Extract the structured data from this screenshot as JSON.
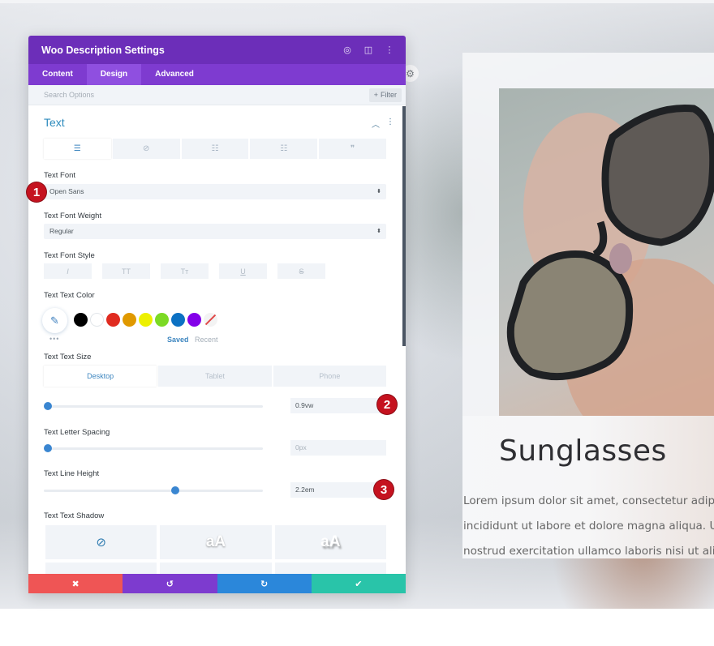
{
  "modal": {
    "title": "Woo Description Settings",
    "header_icons": [
      "focus-icon",
      "split-view-icon",
      "more-vertical-icon"
    ],
    "tabs": [
      {
        "label": "Content",
        "active": false
      },
      {
        "label": "Design",
        "active": true
      },
      {
        "label": "Advanced",
        "active": false
      }
    ],
    "search": {
      "placeholder": "Search Options",
      "value": ""
    },
    "filter_label": "Filter",
    "section": {
      "title": "Text",
      "subtabs": [
        "align-left-icon",
        "link-icon",
        "list-ul-icon",
        "list-ol-icon",
        "quote-icon"
      ],
      "text_font": {
        "label": "Text Font",
        "value": "Open Sans"
      },
      "text_font_weight": {
        "label": "Text Font Weight",
        "value": "Regular"
      },
      "text_font_style": {
        "label": "Text Font Style",
        "buttons": [
          "I",
          "TT",
          "Tт",
          "U",
          "S"
        ]
      },
      "text_color": {
        "label": "Text Text Color",
        "swatches": [
          "#000000",
          "#ffffff",
          "#e02b20",
          "#e09900",
          "#edf000",
          "#7cda24",
          "#0c71c3",
          "#8300e9"
        ],
        "saved_label": "Saved",
        "recent_label": "Recent",
        "more": "•••"
      },
      "text_size": {
        "label": "Text Text Size",
        "devices": [
          {
            "label": "Desktop",
            "active": true
          },
          {
            "label": "Tablet",
            "active": false
          },
          {
            "label": "Phone",
            "active": false
          }
        ],
        "value": "0.9vw",
        "slider_fraction": 0.02
      },
      "letter_spacing": {
        "label": "Text Letter Spacing",
        "value": "0px",
        "slider_fraction": 0.02
      },
      "line_height": {
        "label": "Text Line Height",
        "value": "2.2em",
        "slider_fraction": 0.6
      },
      "text_shadow": {
        "label": "Text Text Shadow",
        "presets": [
          "none",
          "aA",
          "aA"
        ]
      }
    },
    "footer": {
      "buttons": [
        {
          "name": "discard",
          "glyph": "✖",
          "color": "#ef5555"
        },
        {
          "name": "undo",
          "glyph": "↺",
          "color": "#7d3bcf"
        },
        {
          "name": "redo",
          "glyph": "↻",
          "color": "#2b87da"
        },
        {
          "name": "save",
          "glyph": "✔",
          "color": "#29c4a9"
        }
      ]
    }
  },
  "annotations": [
    "1",
    "2",
    "3"
  ],
  "product": {
    "title": "Sunglasses",
    "description_lines": [
      "Lorem ipsum dolor sit amet, consectetur adipiscing",
      "incididunt ut labore et dolore magna aliqua. Ut en",
      "nostrud exercitation ullamco laboris nisi ut aliquip"
    ]
  }
}
